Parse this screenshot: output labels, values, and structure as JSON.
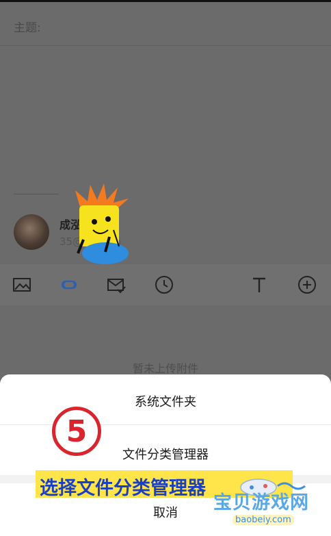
{
  "compose": {
    "subject_label": "主题:",
    "sender_name": "成泓奋香幺",
    "sender_email": "35@qq.com",
    "no_attachment": "暂未上传附件"
  },
  "toolbar": {
    "icons": [
      "image-icon",
      "link-icon",
      "mail-check-icon",
      "clock-icon",
      "text-icon",
      "plus-icon"
    ]
  },
  "sheet": {
    "options": [
      "系统文件夹",
      "文件分类管理器",
      "取消"
    ]
  },
  "overlay": {
    "step_number": "5",
    "banner_text": "选择文件分类管理器",
    "watermark_title": "宝贝游戏网",
    "watermark_url": "baobeiy.com"
  },
  "colors": {
    "accent_red": "#d9262e",
    "banner_yellow": "#ffe44a",
    "banner_text_blue": "#1a3fc7"
  }
}
